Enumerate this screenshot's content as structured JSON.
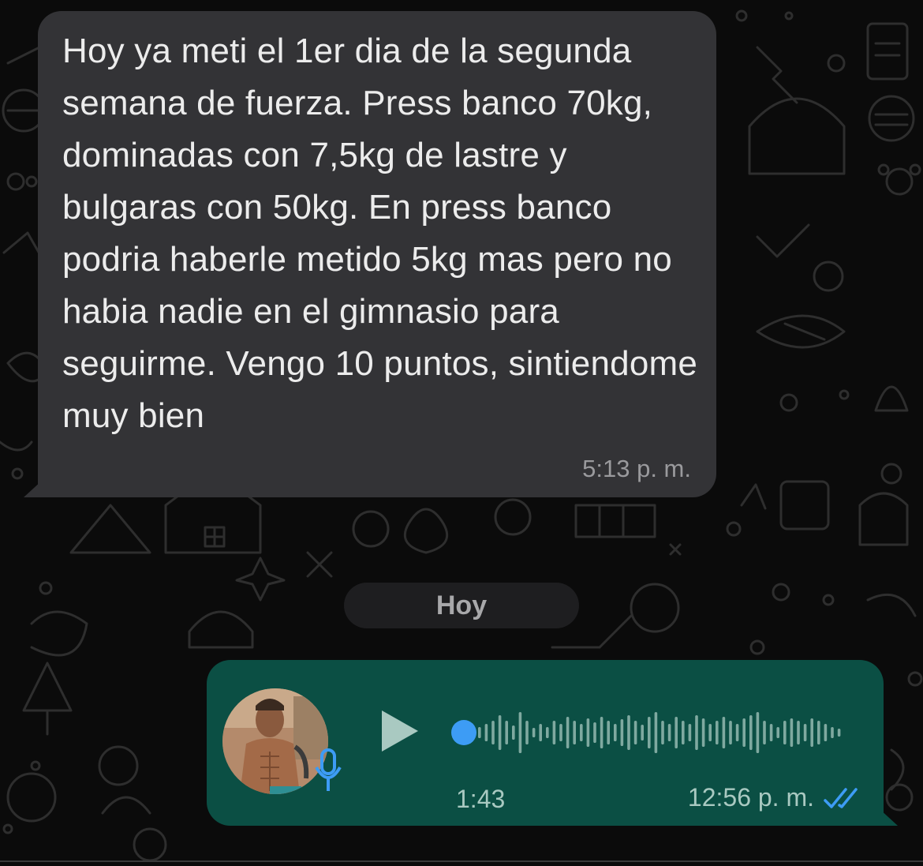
{
  "incoming_message": {
    "text": "Hoy ya meti el 1er dia de la segunda semana de fuerza. Press banco 70kg, dominadas con 7,5kg de lastre y bulgaras con 50kg. En press banco podria haberle metido 5kg mas pero no habia nadie en el gimnasio para seguirme. Vengo 10 puntos, sintiendome muy bien",
    "time": "5:13 p. m."
  },
  "day_divider": {
    "label": "Hoy"
  },
  "voice_message": {
    "duration": "1:43",
    "time": "12:56 p. m.",
    "status_icon": "double-check-read-icon",
    "play_icon": "play-icon",
    "mic_icon": "microphone-icon",
    "progress": 0
  },
  "colors": {
    "background": "#0b0b0b",
    "incoming_bubble": "#333336",
    "outgoing_bubble": "#0b4f44",
    "playhead": "#3d9cf5",
    "read_ticks": "#3d9cf5",
    "mic": "#3d9cf5"
  }
}
